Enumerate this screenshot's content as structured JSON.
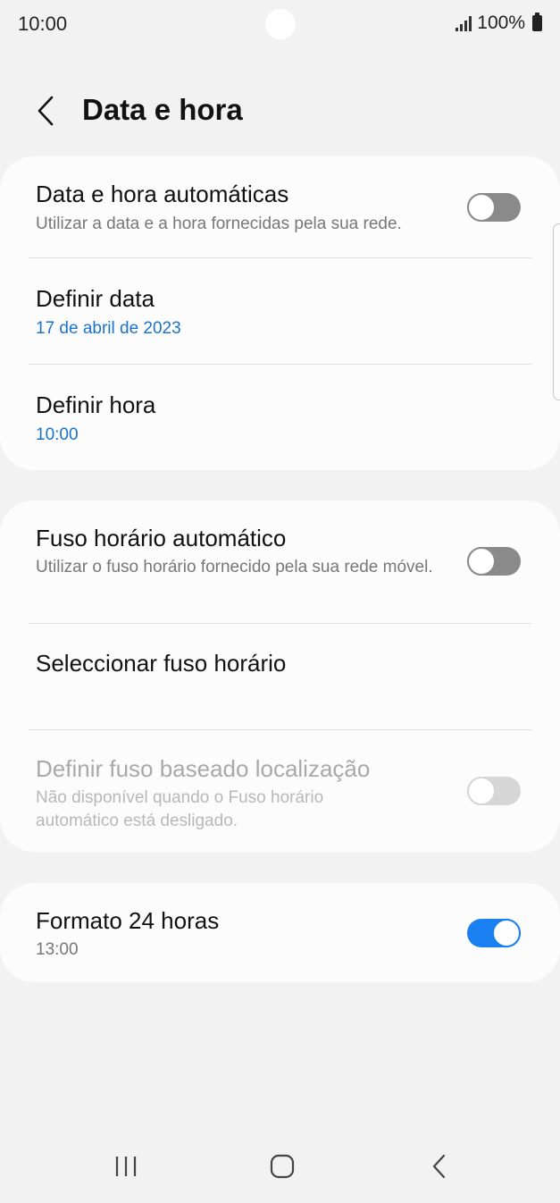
{
  "status_bar": {
    "time": "10:00",
    "battery": "100%"
  },
  "header": {
    "title": "Data e hora",
    "back_icon": "chevron-left-icon"
  },
  "group1": {
    "auto_datetime": {
      "title": "Data e hora automáticas",
      "subtitle": "Utilizar a data e a hora fornecidas pela sua rede.",
      "toggle": "off"
    },
    "set_date": {
      "title": "Definir data",
      "value": "17 de abril de 2023"
    },
    "set_time": {
      "title": "Definir hora",
      "value": "10:00"
    }
  },
  "group2": {
    "auto_timezone": {
      "title": "Fuso horário automático",
      "subtitle": "Utilizar o fuso horário fornecido pela sua rede móvel.",
      "toggle": "off"
    },
    "select_timezone": {
      "title": "Seleccionar fuso horário"
    },
    "location_timezone": {
      "title": "Definir fuso baseado localização",
      "subtitle": "Não disponível quando o Fuso horário automático está desligado.",
      "toggle": "off-disabled"
    }
  },
  "group3": {
    "format_24h": {
      "title": "Formato 24 horas",
      "subtitle": "13:00",
      "toggle": "on"
    }
  },
  "colors": {
    "accent": "#1a7ff0",
    "link_blue": "#1a73c9",
    "toggle_off": "#8a8a8a",
    "background": "#f2f2f2",
    "card": "#fcfcfc"
  },
  "nav_bar": {
    "recents_icon": "recents-icon",
    "home_icon": "home-icon",
    "back_icon": "back-icon"
  }
}
